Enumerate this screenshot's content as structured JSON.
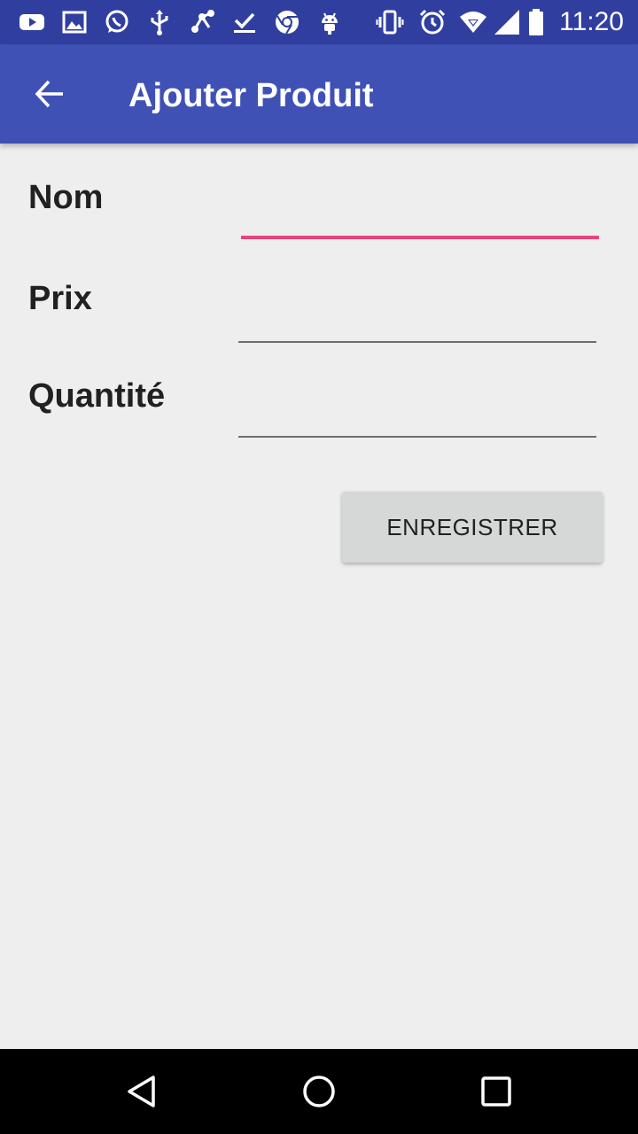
{
  "status_bar": {
    "time": "11:20",
    "background_color": "#303f9f",
    "notification_icons": [
      "youtube-icon",
      "image-icon",
      "whatsapp-icon",
      "usb-icon",
      "share-icon",
      "check-download-icon",
      "chrome-icon",
      "android-icon"
    ],
    "system_icons": [
      "vibrate-icon",
      "alarm-icon",
      "wifi-icon",
      "signal-icon",
      "battery-icon"
    ]
  },
  "app_bar": {
    "title": "Ajouter Produit",
    "background_color": "#3f51b5",
    "back_icon": "arrow-back-icon"
  },
  "form": {
    "fields": [
      {
        "label": "Nom",
        "value": "",
        "focused": true
      },
      {
        "label": "Prix",
        "value": "",
        "focused": false
      },
      {
        "label": "Quantité",
        "value": "",
        "focused": false
      }
    ],
    "accent_color": "#e8437d",
    "save_label": "ENREGISTRER"
  },
  "nav_bar": {
    "buttons": [
      "back-triangle-icon",
      "home-circle-icon",
      "recents-square-icon"
    ]
  }
}
